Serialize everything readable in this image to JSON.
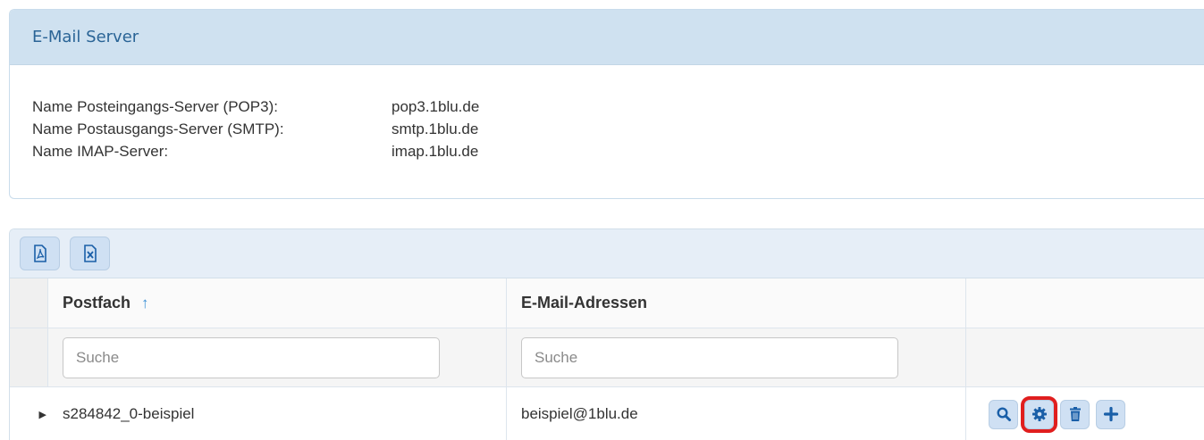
{
  "server_panel": {
    "title": "E-Mail Server",
    "rows": [
      {
        "label": "Name Posteingangs-Server (POP3):",
        "value": "pop3.1blu.de"
      },
      {
        "label": "Name Postausgangs-Server (SMTP):",
        "value": "smtp.1blu.de"
      },
      {
        "label": "Name IMAP-Server:",
        "value": "imap.1blu.de"
      }
    ]
  },
  "toolbar": {
    "buttons": [
      {
        "icon": "pdf-icon"
      },
      {
        "icon": "excel-icon"
      }
    ]
  },
  "table": {
    "columns": [
      {
        "label": "Postfach",
        "sort": "ascending"
      },
      {
        "label": "E-Mail-Adressen"
      },
      {
        "label": ""
      }
    ],
    "filters": {
      "postfach_placeholder": "Suche",
      "email_placeholder": "Suche"
    },
    "rows": [
      {
        "postfach": "s284842_0-beispiel",
        "email": "beispiel@1blu.de",
        "actions": [
          "search-icon",
          "gear-icon",
          "trash-icon",
          "plus-icon"
        ]
      }
    ]
  },
  "colors": {
    "panel_header_bg": "#cfe1f0",
    "title_blue": "#2a6496",
    "button_bg": "#cfe0f3",
    "icon_blue": "#1a5fa8",
    "highlight_red": "#e01e1e",
    "sort_arrow": "#3a8fd6"
  }
}
